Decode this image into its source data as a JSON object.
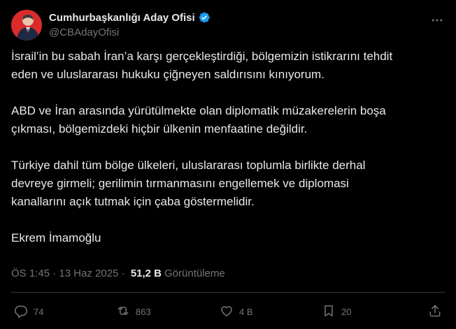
{
  "author": {
    "display_name": "Cumhurbaşkanlığı Aday Ofisi",
    "handle": "@CBAdayOfisi",
    "avatar_icon": "profile-avatar",
    "verified_icon": "verified-badge-icon",
    "verified_color": "#1d9bf0"
  },
  "tweet": {
    "paragraphs": [
      "İsrail’in bu sabah İran’a karşı gerçekleştirdiği, bölgemizin istikrarını tehdit\neden ve uluslararası hukuku çiğneyen saldırısını kınıyorum.",
      "ABD ve İran arasında yürütülmekte olan diplomatik müzakerelerin boşa\nçıkması, bölgemizdeki hiçbir ülkenin menfaatine değildir.",
      "Türkiye dahil tüm bölge ülkeleri, uluslararası toplumla birlikte derhal\ndevreye girmeli; gerilimin tırmanmasını engellemek ve diplomasi\nkanallarını açık tutmak için çaba göstermelidir.",
      "Ekrem İmamoğlu"
    ]
  },
  "meta": {
    "time": "ÖS 1:45",
    "separator": " · ",
    "date": "13 Haz 2025",
    "views_count": "51,2 B",
    "views_label": "Görüntüleme"
  },
  "actions": {
    "reply_count": "74",
    "retweet_count": "863",
    "like_count": "4 B",
    "bookmark_count": "20"
  },
  "colors": {
    "background": "#000000",
    "text": "#e7e9ea",
    "muted": "#71767b",
    "divider": "#2f3336"
  }
}
